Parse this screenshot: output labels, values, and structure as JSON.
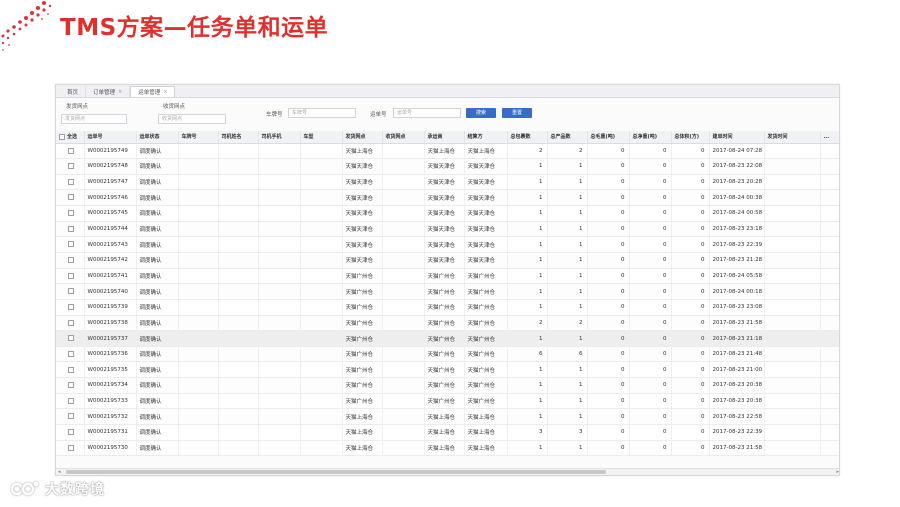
{
  "slide": {
    "title": "TMS方案—任务单和运单"
  },
  "brand": {
    "name": "大数跨境"
  },
  "tabs": [
    {
      "label": "首页",
      "closable": false,
      "active": false
    },
    {
      "label": "订单管理",
      "closable": true,
      "active": false
    },
    {
      "label": "运单管理",
      "closable": true,
      "active": true
    }
  ],
  "filters": {
    "ship_point_label": "发货网点",
    "ship_point_placeholder": "发货网点",
    "recv_point_label": "收货网点",
    "recv_point_placeholder": "收货网点",
    "plate_label": "车牌号",
    "plate_placeholder": "车牌号",
    "waybill_label": "运单号",
    "waybill_placeholder": "运单号",
    "search_button": "搜索",
    "reset_button": "重置"
  },
  "table": {
    "columns": [
      "全选",
      "运单号",
      "运单状态",
      "车牌号",
      "司机姓名",
      "司机手机",
      "车型",
      "发货网点",
      "收货网点",
      "承运商",
      "结算方",
      "总包裹数",
      "总产品数",
      "总毛重(吨)",
      "总净重(吨)",
      "总体积(方)",
      "建单时间",
      "发货时间",
      "..."
    ],
    "rows": [
      {
        "id": "W0002195749",
        "status": "调度确认",
        "ship": "天猫上海仓",
        "recv": "",
        "carrier": "天猫上海仓",
        "payer": "天猫上海仓",
        "pkgs": "2",
        "prods": "2",
        "gross": "0",
        "net": "0",
        "vol": "0",
        "created": "2017-08-24 07:28"
      },
      {
        "id": "W0002195748",
        "status": "调度确认",
        "ship": "天猫天津仓",
        "recv": "",
        "carrier": "天猫天津仓",
        "payer": "天猫天津仓",
        "pkgs": "1",
        "prods": "1",
        "gross": "0",
        "net": "0",
        "vol": "0",
        "created": "2017-08-23 22:08"
      },
      {
        "id": "W0002195747",
        "status": "调度确认",
        "ship": "天猫天津仓",
        "recv": "",
        "carrier": "天猫天津仓",
        "payer": "天猫天津仓",
        "pkgs": "1",
        "prods": "1",
        "gross": "0",
        "net": "0",
        "vol": "0",
        "created": "2017-08-23 20:28"
      },
      {
        "id": "W0002195746",
        "status": "调度确认",
        "ship": "天猫天津仓",
        "recv": "",
        "carrier": "天猫天津仓",
        "payer": "天猫天津仓",
        "pkgs": "1",
        "prods": "1",
        "gross": "0",
        "net": "0",
        "vol": "0",
        "created": "2017-08-24 00:38"
      },
      {
        "id": "W0002195745",
        "status": "调度确认",
        "ship": "天猫天津仓",
        "recv": "",
        "carrier": "天猫天津仓",
        "payer": "天猫天津仓",
        "pkgs": "1",
        "prods": "1",
        "gross": "0",
        "net": "0",
        "vol": "0",
        "created": "2017-08-24 00:58"
      },
      {
        "id": "W0002195744",
        "status": "调度确认",
        "ship": "天猫天津仓",
        "recv": "",
        "carrier": "天猫天津仓",
        "payer": "天猫天津仓",
        "pkgs": "1",
        "prods": "1",
        "gross": "0",
        "net": "0",
        "vol": "0",
        "created": "2017-08-23 23:18"
      },
      {
        "id": "W0002195743",
        "status": "调度确认",
        "ship": "天猫天津仓",
        "recv": "",
        "carrier": "天猫天津仓",
        "payer": "天猫天津仓",
        "pkgs": "1",
        "prods": "1",
        "gross": "0",
        "net": "0",
        "vol": "0",
        "created": "2017-08-23 22:39"
      },
      {
        "id": "W0002195742",
        "status": "调度确认",
        "ship": "天猫天津仓",
        "recv": "",
        "carrier": "天猫天津仓",
        "payer": "天猫天津仓",
        "pkgs": "1",
        "prods": "1",
        "gross": "0",
        "net": "0",
        "vol": "0",
        "created": "2017-08-23 21:28"
      },
      {
        "id": "W0002195741",
        "status": "调度确认",
        "ship": "天猫广州仓",
        "recv": "",
        "carrier": "天猫广州仓",
        "payer": "天猫广州仓",
        "pkgs": "1",
        "prods": "1",
        "gross": "0",
        "net": "0",
        "vol": "0",
        "created": "2017-08-24 05:58"
      },
      {
        "id": "W0002195740",
        "status": "调度确认",
        "ship": "天猫广州仓",
        "recv": "",
        "carrier": "天猫广州仓",
        "payer": "天猫广州仓",
        "pkgs": "1",
        "prods": "1",
        "gross": "0",
        "net": "0",
        "vol": "0",
        "created": "2017-08-24 00:18"
      },
      {
        "id": "W0002195739",
        "status": "调度确认",
        "ship": "天猫广州仓",
        "recv": "",
        "carrier": "天猫广州仓",
        "payer": "天猫广州仓",
        "pkgs": "1",
        "prods": "1",
        "gross": "0",
        "net": "0",
        "vol": "0",
        "created": "2017-08-23 23:08"
      },
      {
        "id": "W0002195738",
        "status": "调度确认",
        "ship": "天猫广州仓",
        "recv": "",
        "carrier": "天猫广州仓",
        "payer": "天猫广州仓",
        "pkgs": "2",
        "prods": "2",
        "gross": "0",
        "net": "0",
        "vol": "0",
        "created": "2017-08-23 21:58"
      },
      {
        "id": "W0002195737",
        "status": "调度确认",
        "ship": "天猫广州仓",
        "recv": "",
        "carrier": "天猫广州仓",
        "payer": "天猫广州仓",
        "pkgs": "1",
        "prods": "1",
        "gross": "0",
        "net": "0",
        "vol": "0",
        "created": "2017-08-23 21:18"
      },
      {
        "id": "W0002195736",
        "status": "调度确认",
        "ship": "天猫广州仓",
        "recv": "",
        "carrier": "天猫广州仓",
        "payer": "天猫广州仓",
        "pkgs": "6",
        "prods": "6",
        "gross": "0",
        "net": "0",
        "vol": "0",
        "created": "2017-08-23 21:48"
      },
      {
        "id": "W0002195735",
        "status": "调度确认",
        "ship": "天猫广州仓",
        "recv": "",
        "carrier": "天猫广州仓",
        "payer": "天猫广州仓",
        "pkgs": "1",
        "prods": "1",
        "gross": "0",
        "net": "0",
        "vol": "0",
        "created": "2017-08-23 21:00"
      },
      {
        "id": "W0002195734",
        "status": "调度确认",
        "ship": "天猫广州仓",
        "recv": "",
        "carrier": "天猫广州仓",
        "payer": "天猫广州仓",
        "pkgs": "1",
        "prods": "1",
        "gross": "0",
        "net": "0",
        "vol": "0",
        "created": "2017-08-23 20:38"
      },
      {
        "id": "W0002195733",
        "status": "调度确认",
        "ship": "天猫广州仓",
        "recv": "",
        "carrier": "天猫广州仓",
        "payer": "天猫广州仓",
        "pkgs": "1",
        "prods": "1",
        "gross": "0",
        "net": "0",
        "vol": "0",
        "created": "2017-08-23 20:38"
      },
      {
        "id": "W0002195732",
        "status": "调度确认",
        "ship": "天猫上海仓",
        "recv": "",
        "carrier": "天猫上海仓",
        "payer": "天猫上海仓",
        "pkgs": "1",
        "prods": "1",
        "gross": "0",
        "net": "0",
        "vol": "0",
        "created": "2017-08-23 22:58"
      },
      {
        "id": "W0002195731",
        "status": "调度确认",
        "ship": "天猫上海仓",
        "recv": "",
        "carrier": "天猫上海仓",
        "payer": "天猫上海仓",
        "pkgs": "3",
        "prods": "3",
        "gross": "0",
        "net": "0",
        "vol": "0",
        "created": "2017-08-23 22:39"
      },
      {
        "id": "W0002195730",
        "status": "调度确认",
        "ship": "天猫上海仓",
        "recv": "",
        "carrier": "天猫上海仓",
        "payer": "天猫上海仓",
        "pkgs": "1",
        "prods": "1",
        "gross": "0",
        "net": "0",
        "vol": "0",
        "created": "2017-08-23 21:58"
      }
    ],
    "highlighted_row": 12
  },
  "colors": {
    "title": "#e0302e",
    "button": "#3b6bc9",
    "highlight_row": "#eeeeee"
  }
}
